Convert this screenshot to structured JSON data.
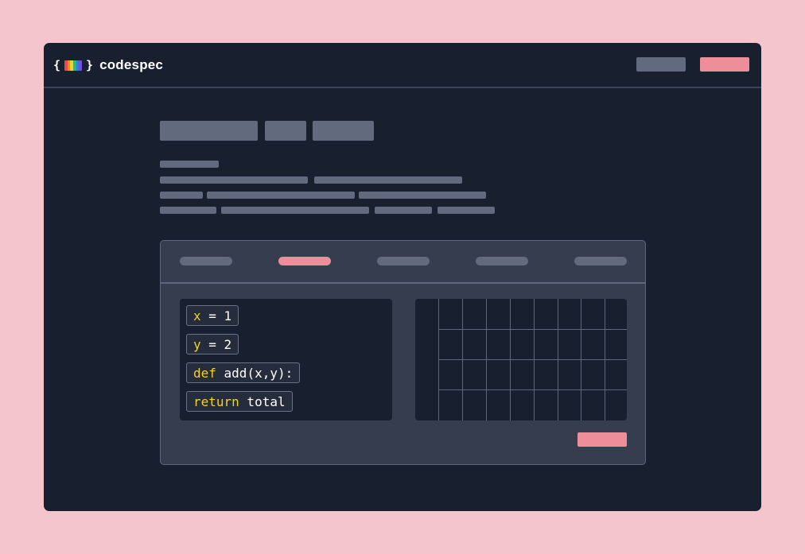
{
  "brand": {
    "open_brace": "{",
    "close_brace": "}",
    "name": "codespec",
    "rainbow_colors": [
      "#e84a4a",
      "#f28c28",
      "#f5d02a",
      "#3cb371",
      "#2f7de1",
      "#7b4cd8"
    ]
  },
  "colors": {
    "page_background": "#f4c5cc",
    "window_background": "#181f2f",
    "panel_background": "#363d4f",
    "placeholder": "#626b7e",
    "accent": "#ee8e9b",
    "keyword": "#f5d02a"
  },
  "tabs": [
    {
      "active": false
    },
    {
      "active": true
    },
    {
      "active": false
    },
    {
      "active": false
    },
    {
      "active": false
    }
  ],
  "code_lines": [
    {
      "keyword": "x",
      "rest": " = 1"
    },
    {
      "keyword": "y",
      "rest": " = 2"
    },
    {
      "keyword": "def",
      "rest": " add(x,y):"
    },
    {
      "keyword": "return",
      "rest": " total"
    }
  ]
}
